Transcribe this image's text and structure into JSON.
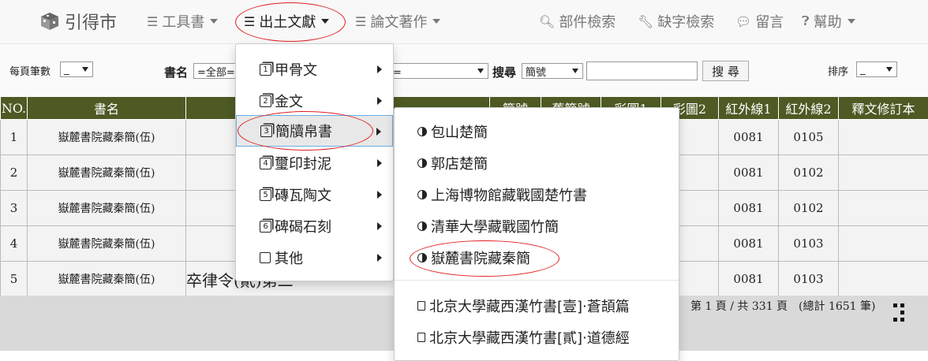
{
  "navbar": {
    "brand": "引得市",
    "items": [
      {
        "label": "工具書"
      },
      {
        "label": "出土文獻"
      },
      {
        "label": "論文著作"
      }
    ],
    "right": [
      {
        "label": "部件檢索"
      },
      {
        "label": "缺字檢索"
      },
      {
        "label": "留言"
      },
      {
        "label": "幫助"
      }
    ]
  },
  "toolbar": {
    "per_page_label": "每頁筆數",
    "per_page_value": "_",
    "book_label": "書名",
    "book_value": "=全部=",
    "category_value": "部=",
    "search_label": "搜尋",
    "search_field_value": "簡號",
    "search_input_value": "",
    "search_button": "搜 尋",
    "sort_label": "排序",
    "sort_value": "_"
  },
  "table": {
    "headers": [
      "NO.",
      "書名",
      "",
      "簡號",
      "舊簡號",
      "彩圖1",
      "彩圖2",
      "紅外線1",
      "紅外線2",
      "釋文修訂本"
    ],
    "rows": [
      {
        "no": "1",
        "name": "嶽麓書院藏秦簡(伍)",
        "ir1": "0081",
        "ir2": "0105"
      },
      {
        "no": "2",
        "name": "嶽麓書院藏秦簡(伍)",
        "ir1": "0081",
        "ir2": "0102"
      },
      {
        "no": "3",
        "name": "嶽麓書院藏秦簡(伍)",
        "ir1": "0081",
        "ir2": "0102"
      },
      {
        "no": "4",
        "name": "嶽麓書院藏秦簡(伍)",
        "ir1": "0081",
        "ir2": "0103"
      },
      {
        "no": "5",
        "name": "嶽麓書院藏秦簡(伍)",
        "ir1": "0081",
        "ir2": "0103"
      }
    ],
    "partial_text": "卒律令(貳)第二"
  },
  "pagination": {
    "info": "第 1 頁 / 共 331 頁　(總計 1651 筆)"
  },
  "menu_level1": {
    "items": [
      {
        "label": "甲骨文",
        "num": "1"
      },
      {
        "label": "金文",
        "num": "2"
      },
      {
        "label": "簡牘帛書",
        "num": "3"
      },
      {
        "label": "璽印封泥",
        "num": "4"
      },
      {
        "label": "磚瓦陶文",
        "num": "5"
      },
      {
        "label": "碑碣石刻",
        "num": "6"
      },
      {
        "label": "其他",
        "num": ""
      }
    ]
  },
  "menu_level2": {
    "items": [
      {
        "label": "包山楚簡"
      },
      {
        "label": "郭店楚簡"
      },
      {
        "label": "上海博物館藏戰國楚竹書"
      },
      {
        "label": "清華大學藏戰國竹簡"
      },
      {
        "label": "嶽麓書院藏秦簡"
      },
      {
        "label": "北京大學藏西漢竹書[壹]‧蒼頡篇"
      },
      {
        "label": "北京大學藏西漢竹書[貳]‧道德經"
      }
    ]
  },
  "colors": {
    "header_bg": "#4d5a24",
    "highlight_oval": "#e02020",
    "active_border": "#66afe9"
  }
}
